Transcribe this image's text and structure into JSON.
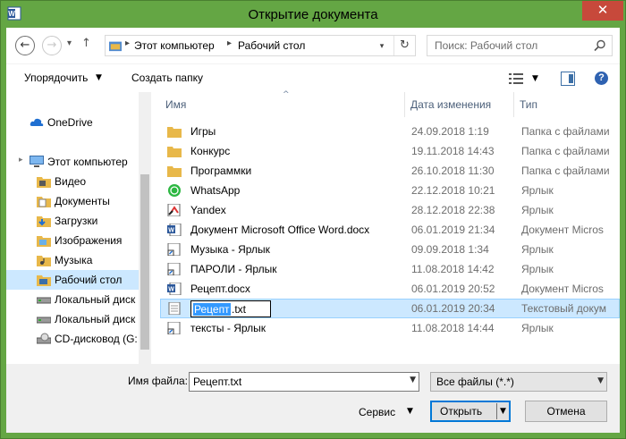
{
  "window": {
    "title": "Открытие документа",
    "close_glyph": "✕"
  },
  "nav": {
    "back_glyph": "←",
    "forward_glyph": "→",
    "recent_glyph": "▾",
    "up_glyph": "↑",
    "breadcrumb": [
      "Этот компьютер",
      "Рабочий стол"
    ],
    "separator_glyph": "▸",
    "dropdown_glyph": "▾",
    "refresh_glyph": "↻",
    "search_placeholder": "Поиск: Рабочий стол"
  },
  "toolbar": {
    "organize_label": "Упорядочить",
    "organize_arrow": "▼",
    "new_folder_label": "Создать папку",
    "view_arrow": "▼",
    "help_glyph": "?"
  },
  "sidebar": {
    "items": [
      {
        "label": "OneDrive",
        "icon": "cloud-icon"
      },
      {
        "label": "Этот компьютер",
        "icon": "computer-icon"
      },
      {
        "label": "Видео",
        "icon": "folder-icon"
      },
      {
        "label": "Документы",
        "icon": "folder-icon"
      },
      {
        "label": "Загрузки",
        "icon": "folder-icon"
      },
      {
        "label": "Изображения",
        "icon": "folder-icon"
      },
      {
        "label": "Музыка",
        "icon": "folder-icon"
      },
      {
        "label": "Рабочий стол",
        "icon": "folder-icon"
      },
      {
        "label": "Локальный диск",
        "icon": "drive-icon"
      },
      {
        "label": "Локальный диск",
        "icon": "drive-icon"
      },
      {
        "label": "CD-дисковод (G:",
        "icon": "cd-drive-icon"
      }
    ],
    "selected": "Рабочий стол",
    "expand_glyph": "▸"
  },
  "file_list": {
    "columns": [
      "Имя",
      "Дата изменения",
      "Тип"
    ],
    "sort_glyph": "^",
    "rows": [
      {
        "name": "Игры",
        "date": "24.09.2018 1:19",
        "type": "Папка с файлами",
        "icon": "folder-icon"
      },
      {
        "name": "Конкурс",
        "date": "19.11.2018 14:43",
        "type": "Папка с файлами",
        "icon": "folder-icon"
      },
      {
        "name": "Программки",
        "date": "26.10.2018 11:30",
        "type": "Папка с файлами",
        "icon": "folder-icon"
      },
      {
        "name": "WhatsApp",
        "date": "22.12.2018 10:21",
        "type": "Ярлык",
        "icon": "whatsapp-icon"
      },
      {
        "name": "Yandex",
        "date": "28.12.2018 22:38",
        "type": "Ярлык",
        "icon": "yandex-icon"
      },
      {
        "name": "Документ Microsoft Office Word.docx",
        "date": "06.01.2019 21:34",
        "type": "Документ Micros",
        "icon": "word-doc-icon"
      },
      {
        "name": "Музыка - Ярлык",
        "date": "09.09.2018 1:34",
        "type": "Ярлык",
        "icon": "shortcut-icon"
      },
      {
        "name": "ПАРОЛИ - Ярлык",
        "date": "11.08.2018 14:42",
        "type": "Ярлык",
        "icon": "shortcut-icon"
      },
      {
        "name": "Рецепт.docx",
        "date": "06.01.2019 20:52",
        "type": "Документ Micros",
        "icon": "word-doc-icon"
      },
      {
        "name": "Рецепт.txt",
        "date": "06.01.2019 20:34",
        "type": "Текстовый докум",
        "icon": "text-file-icon",
        "rename_selected": "Рецепт",
        "rename_rest": ".txt"
      },
      {
        "name": "тексты - Ярлык",
        "date": "11.08.2018 14:44",
        "type": "Ярлык",
        "icon": "shortcut-icon"
      }
    ],
    "selected_index": 9
  },
  "footer": {
    "filename_label": "Имя файла:",
    "filename_value": "Рецепт.txt",
    "filetype_value": "Все файлы (*.*)",
    "dropdown_glyph": "▼",
    "tools_label": "Сервис",
    "tools_arrow": "▼",
    "open_label": "Открыть",
    "open_arrow": "▼",
    "cancel_label": "Отмена"
  },
  "colors": {
    "title_bar": "#64a644",
    "close_button": "#c7493b",
    "selection": "#cce8ff",
    "folder": "#e8b84a",
    "whatsapp": "#2db742",
    "word": "#2b579a"
  }
}
